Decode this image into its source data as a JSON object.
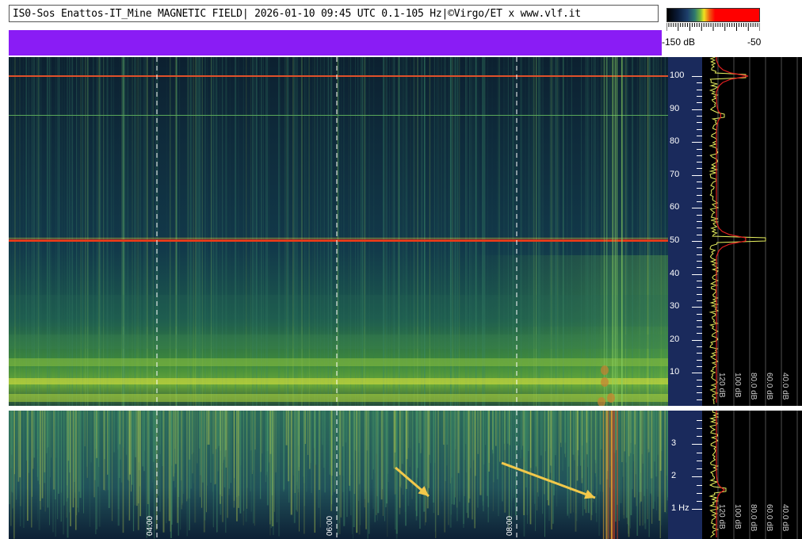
{
  "header": {
    "title": "IS0-Sos Enattos-IT_Mine MAGNETIC FIELD| 2026-01-10 09:45 UTC 0.1-105 Hz|©Virgo/ET x www.vlf.it"
  },
  "scale": {
    "min_label": "-150 dB",
    "max_label": "-50"
  },
  "freq_axis_top": {
    "labels": [
      "100",
      "90",
      "80",
      "70",
      "60",
      "50",
      "40",
      "30",
      "20",
      "10"
    ]
  },
  "freq_axis_bottom": {
    "labels": [
      "3",
      "2",
      "1 Hz"
    ]
  },
  "time_axis": {
    "labels": [
      "04:00",
      "06:00",
      "08:00"
    ]
  },
  "profile_top": {
    "db_labels": [
      "120 dB",
      "100 dB",
      "80.0 dB",
      "60.0 dB",
      "40.0 dB"
    ]
  },
  "profile_bottom": {
    "db_labels": [
      "120 dB",
      "100 dB",
      "80.0 dB",
      "60.0 dB",
      "40.0 dB"
    ]
  },
  "colors": {
    "background_dark": "#0d2a3e",
    "noise_green": "#5fa84a",
    "line_red": "#e33a1a",
    "purple": "#8a1cf5",
    "arrow": "#f2c84a"
  }
}
